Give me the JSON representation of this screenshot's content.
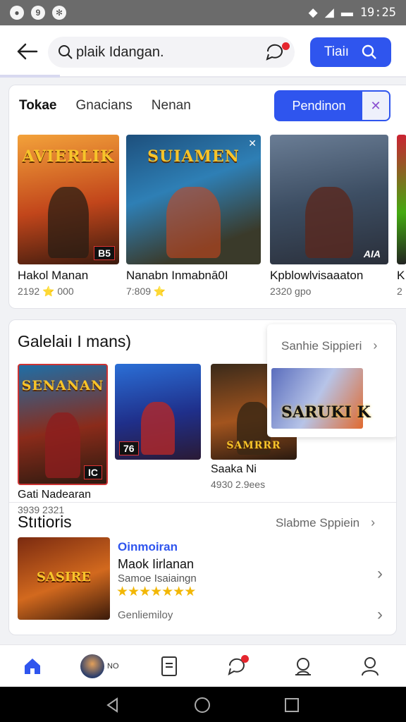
{
  "status_bar": {
    "time": "19:25"
  },
  "header": {
    "search_text": "plaik Idangan.",
    "primary_button_label": "Tiaiı",
    "icons": [
      "back-arrow-icon",
      "search-icon",
      "chat-icon",
      "search-icon"
    ]
  },
  "top_section": {
    "tabs": [
      {
        "label": "Tokae",
        "active": true
      },
      {
        "label": "Gnacians",
        "active": false
      },
      {
        "label": "Nenan",
        "active": false
      }
    ],
    "tab_button_label": "Pendinon",
    "games": [
      {
        "art_title": "AVIERLIK",
        "badge": "B5",
        "name": "Hakol Manan",
        "meta": "2192 ⭐ 000"
      },
      {
        "art_title": "SUIAMEN",
        "badge": "✕",
        "name": "Nanabn Inmabnā0I",
        "meta": "7:809 ⭐"
      },
      {
        "art_title": "",
        "badge": "AIA",
        "name": "Kpblowlvisaaaton",
        "meta": "2320 gpo"
      },
      {
        "art_title": "",
        "badge": "",
        "name": "K",
        "meta": "2"
      }
    ]
  },
  "gallery": {
    "title": "Galelaiı I mans)",
    "link": "Sanhie Sippieri",
    "popup_title": "SARUKI K",
    "items": [
      {
        "art_title": "SENANAN",
        "badge": "IC",
        "name": "Gati Nadearan",
        "meta": "3939 2321"
      },
      {
        "art_title": "",
        "badge": "76",
        "name": "",
        "meta": ""
      },
      {
        "art_title": "SAMRRR",
        "badge": "",
        "name": "Saaka Ni",
        "meta": "4930 2.9ees"
      }
    ]
  },
  "stories": {
    "title": "Stıtioris",
    "link": "Slabme Sppiein",
    "item": {
      "art_title": "SASIRE",
      "kicker": "Oinmoiran",
      "title": "Maok Iirlanan",
      "subtitle": "Samoe Isaiaingn",
      "rating": "★★★★★★★",
      "footer": "Genliemiloy"
    }
  },
  "bottom_nav": {
    "items": [
      "home",
      "profile",
      "document",
      "chat",
      "support",
      "account"
    ],
    "avatar_label": "NO"
  },
  "colors": {
    "accent": "#2f55ee",
    "badge_red": "#e5262e"
  }
}
